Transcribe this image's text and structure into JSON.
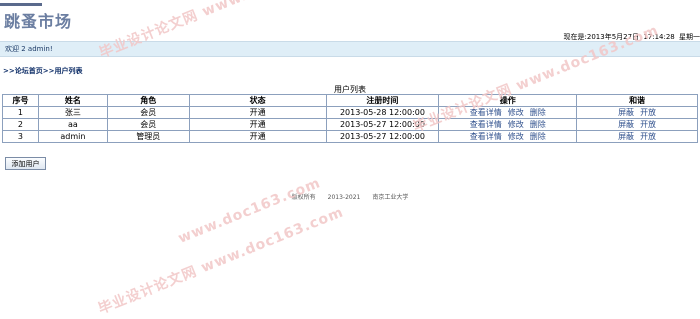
{
  "header": {
    "brand": "跳蚤市场",
    "clock_label": "现在是:2013年5月27日",
    "clock_time": "17:14:28",
    "clock_weekday": "星期一"
  },
  "welcome": {
    "text": "欢迎 2  admin!"
  },
  "breadcrumb": {
    "prefix": ">>",
    "home": "论坛首页",
    "sep": ">>",
    "current": "用户列表"
  },
  "table": {
    "caption": "用户列表",
    "columns": [
      "序号",
      "姓名",
      "角色",
      "状态",
      "注册时间",
      "操作",
      "和谐"
    ],
    "rows": [
      {
        "id": "1",
        "name": "张三",
        "role": "会员",
        "status": "开通",
        "registered": "2013-05-28 12:00:00"
      },
      {
        "id": "2",
        "name": "aa",
        "role": "会员",
        "status": "开通",
        "registered": "2013-05-27 12:00:00"
      },
      {
        "id": "3",
        "name": "admin",
        "role": "管理员",
        "status": "开通",
        "registered": "2013-05-27 12:00:00"
      }
    ],
    "actions": {
      "view": "查看详情",
      "edit": "修改",
      "delete": "删除"
    },
    "moderation": {
      "block": "屏蔽",
      "open": "开放"
    }
  },
  "add_button": "添加用户",
  "footer": {
    "copyright": "版权所有",
    "years": "2013-2021",
    "org": "南京工业大学"
  },
  "watermarks": [
    "毕业设计论文网 www.doc163.com",
    "毕业设计论文网 www.doc163.com",
    "www.doc163.com",
    "毕业设计论文网 www.doc163.com"
  ],
  "colors": {
    "brand": "#6b7ea1",
    "welcome_bg": "#dfeef7",
    "link": "#2e4f8c",
    "table_border": "#8ca0bd",
    "watermark": "#f2c7c7"
  }
}
